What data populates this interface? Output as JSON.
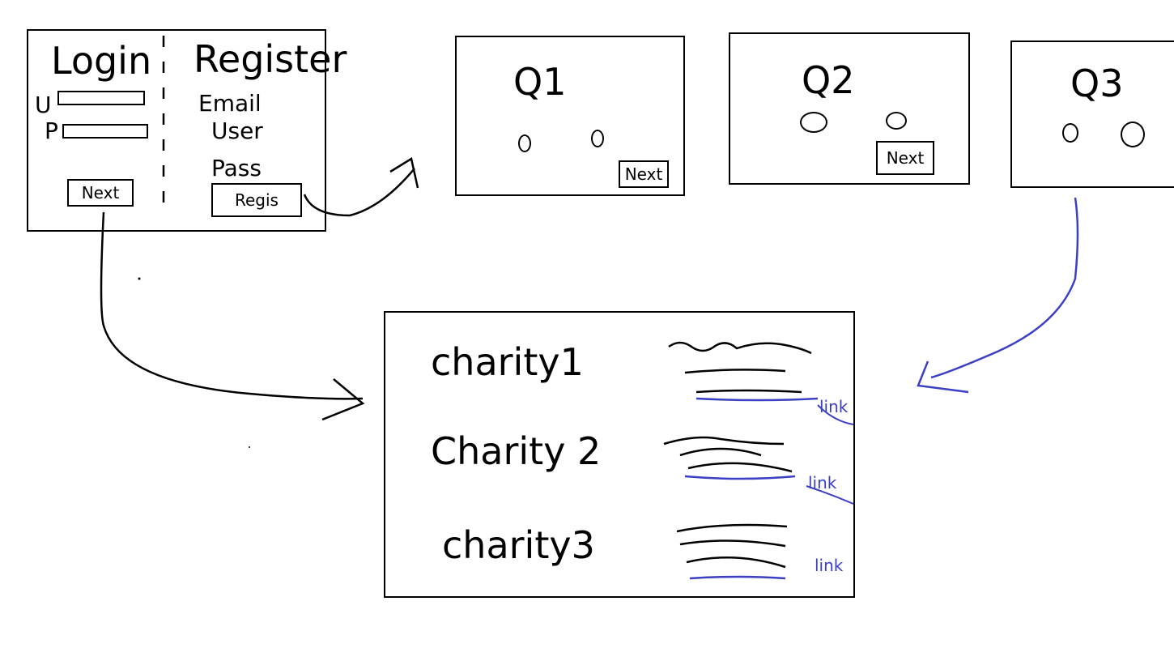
{
  "login_screen": {
    "login_title": "Login",
    "user_label": "U",
    "pass_label": "P",
    "next_button": "Next",
    "register_title": "Register",
    "email_label": "Email",
    "user_field_label": "User",
    "pass_field_label": "Pass",
    "register_button": "Regis"
  },
  "questions": [
    {
      "title": "Q1",
      "button": "Next"
    },
    {
      "title": "Q2",
      "button": "Next"
    },
    {
      "title": "Q3"
    }
  ],
  "charity_list": {
    "items": [
      {
        "name": "charity1",
        "link": "link"
      },
      {
        "name": "Charity 2",
        "link": "link"
      },
      {
        "name": "charity3",
        "link": "link"
      }
    ]
  },
  "colors": {
    "ink": "#000000",
    "blue_ink": "#3b3fc4"
  }
}
